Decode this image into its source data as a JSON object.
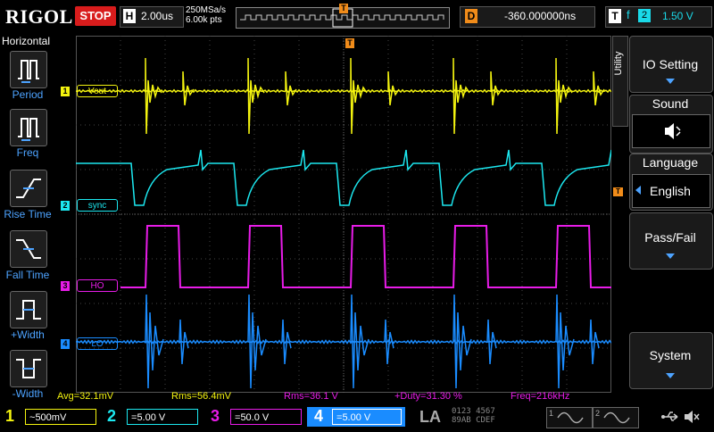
{
  "top": {
    "brand": "RIGOL",
    "run_state": "STOP",
    "horizontal_label": "H",
    "timebase": "2.00us",
    "sample_rate": "250MSa/s",
    "memory_depth": "6.00k pts",
    "trigger_pos_marker": "T",
    "delay_label": "D",
    "delay_value": "-360.000000ns",
    "trigger_label": "T",
    "trigger_edge": "f",
    "trigger_source": "2",
    "trigger_level": "1.50 V"
  },
  "left_panel": {
    "title": "Horizontal",
    "items": [
      {
        "label": "Period",
        "icon": "period-icon"
      },
      {
        "label": "Freq",
        "icon": "freq-icon"
      },
      {
        "label": "Rise Time",
        "icon": "rise-time-icon"
      },
      {
        "label": "Fall Time",
        "icon": "fall-time-icon"
      },
      {
        "label": "+Width",
        "icon": "positive-width-icon"
      },
      {
        "label": "-Width",
        "icon": "negative-width-icon"
      }
    ]
  },
  "channels": [
    {
      "num": "1",
      "name": "Vout",
      "color": "#f4f40f",
      "scale": "500mV",
      "coupling": "~"
    },
    {
      "num": "2",
      "name": "sync",
      "color": "#1ce8f0",
      "scale": "5.00 V",
      "coupling": "="
    },
    {
      "num": "3",
      "name": "HO",
      "color": "#e81ce8",
      "scale": "50.0 V",
      "coupling": "="
    },
    {
      "num": "4",
      "name": "LO",
      "color": "#1a8cff",
      "scale": "5.00 V",
      "coupling": "="
    }
  ],
  "right_panel": {
    "utility_tab": "Utility",
    "io_setting": "IO Setting",
    "sound_title": "Sound",
    "language_title": "Language",
    "language_value": "English",
    "pass_fail": "Pass/Fail",
    "system": "System"
  },
  "measurements": {
    "avg": "Avg=32.1mV",
    "rms1": "Rms=56.4mV",
    "rms2": "Rms=36.1 V",
    "duty": "+Duty=31.30 %",
    "freq": "Freq=216kHz"
  },
  "bottom": {
    "la_label": "LA",
    "la_bits_top": "0123 4567",
    "la_bits_bottom": "89AB CDEF",
    "gen1": "1",
    "gen2": "2"
  },
  "colors": {
    "ch1": "#f4f40f",
    "ch2": "#1ce8f0",
    "ch3": "#e81ce8",
    "ch4": "#1a8cff",
    "accent": "#f18c1a",
    "stop_red": "#d81c1c"
  }
}
